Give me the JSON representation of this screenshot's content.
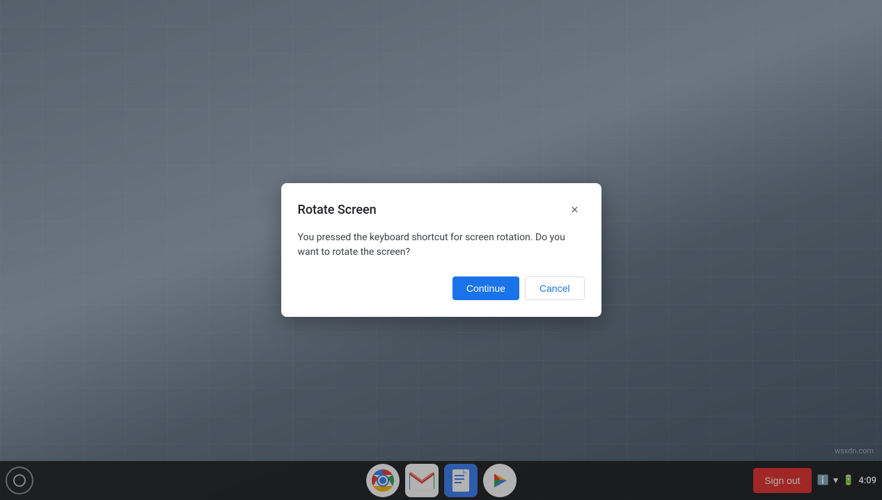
{
  "desktop": {
    "background_desc": "Modern building architecture background"
  },
  "dialog": {
    "title": "Rotate Screen",
    "message": "You pressed the keyboard shortcut for screen rotation. Do you want to rotate the screen?",
    "close_label": "×",
    "continue_label": "Continue",
    "cancel_label": "Cancel"
  },
  "taskbar": {
    "launcher_label": "Launcher",
    "dock_icons": [
      {
        "name": "chrome",
        "label": "Google Chrome"
      },
      {
        "name": "gmail",
        "label": "Gmail"
      },
      {
        "name": "docs",
        "label": "Google Docs"
      },
      {
        "name": "play",
        "label": "Google Play"
      }
    ],
    "sign_out_label": "Sign out",
    "time": "4:09",
    "tray": {
      "info_icon": "ℹ",
      "network_icon": "▾",
      "battery_icon": "🔋"
    }
  },
  "watermark": {
    "text": "wsxdn.com"
  }
}
